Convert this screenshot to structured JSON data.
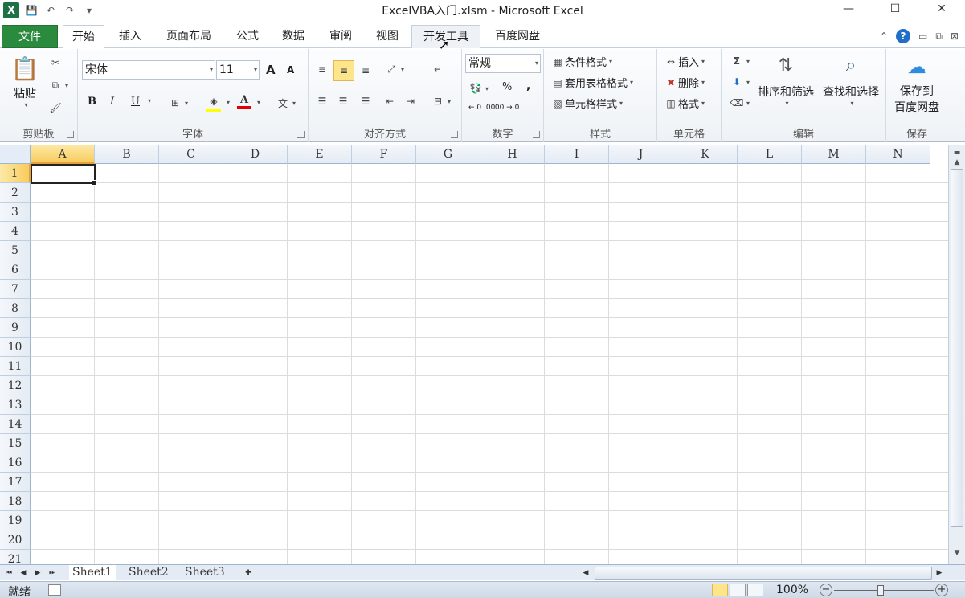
{
  "window": {
    "title": "ExcelVBA入门.xlsm - Microsoft Excel",
    "minimize": "—",
    "maximize": "☐",
    "close": "✕"
  },
  "qat": {
    "logo": "X",
    "save": "💾",
    "undo": "↶",
    "redo": "↷",
    "customize": "▾"
  },
  "tabs": {
    "file": "文件",
    "home": "开始",
    "insert": "插入",
    "page_layout": "页面布局",
    "formulas": "公式",
    "data": "数据",
    "review": "审阅",
    "view": "视图",
    "developer": "开发工具",
    "baidu": "百度网盘"
  },
  "ribbon": {
    "clipboard": {
      "label": "剪贴板",
      "paste": "粘贴"
    },
    "font": {
      "label": "字体",
      "font_name": "宋体",
      "font_size": "11",
      "bold": "B",
      "italic": "I",
      "underline": "U",
      "font_color_glyph": "A",
      "grow": "A",
      "shrink": "A",
      "phonetic": "wén\n变"
    },
    "alignment": {
      "label": "对齐方式"
    },
    "number": {
      "label": "数字",
      "format": "常规",
      "percent": "%",
      "comma": ",",
      "inc_dec": "+.0\n.00",
      "dec_dec": ".00\n+.0"
    },
    "styles": {
      "label": "样式",
      "conditional": "条件格式",
      "table": "套用表格格式",
      "cell": "单元格样式"
    },
    "cells": {
      "label": "单元格",
      "insert": "插入",
      "delete": "删除",
      "format": "格式"
    },
    "editing": {
      "label": "编辑",
      "sum": "Σ",
      "sort_filter": "排序和筛选",
      "find_select": "查找和选择"
    },
    "save": {
      "label": "保存",
      "save_to_line1": "保存到",
      "save_to_line2": "百度网盘"
    }
  },
  "sheet": {
    "columns": [
      "A",
      "B",
      "C",
      "D",
      "E",
      "F",
      "G",
      "H",
      "I",
      "J",
      "K",
      "L",
      "M",
      "N"
    ],
    "rows": [
      "1",
      "2",
      "3",
      "4",
      "5",
      "6",
      "7",
      "8",
      "9",
      "10",
      "11",
      "12",
      "13",
      "14",
      "15",
      "16",
      "17",
      "18",
      "19",
      "20",
      "21"
    ],
    "active_cell": "A1"
  },
  "sheet_tabs": [
    "Sheet1",
    "Sheet2",
    "Sheet3"
  ],
  "status": {
    "ready": "就绪",
    "zoom": "100%",
    "zoom_minus": "−",
    "zoom_plus": "+"
  }
}
